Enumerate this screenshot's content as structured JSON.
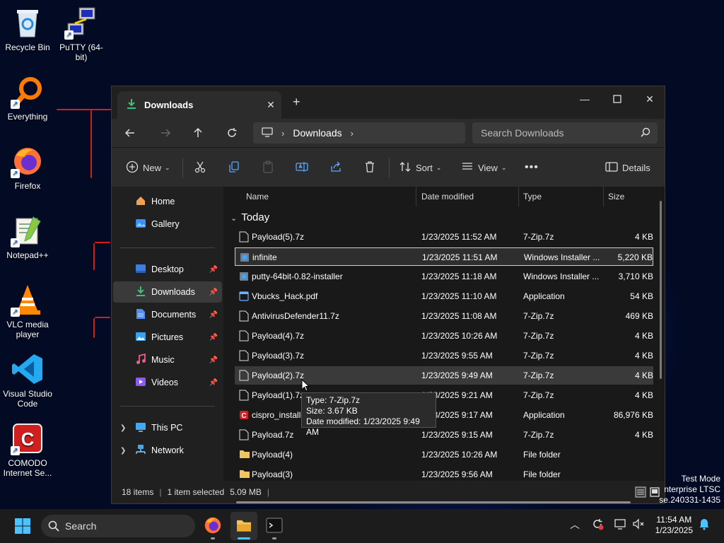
{
  "desktop": {
    "icons": [
      {
        "label": "Recycle Bin"
      },
      {
        "label": "PuTTY (64-bit)"
      },
      {
        "label": "Everything"
      },
      {
        "label": "Firefox"
      },
      {
        "label": "Notepad++"
      },
      {
        "label": "VLC media player"
      },
      {
        "label": "Visual Studio Code"
      },
      {
        "label": "COMODO Internet Se..."
      }
    ]
  },
  "window": {
    "tab_title": "Downloads",
    "nav": {
      "address": "Downloads",
      "search_placeholder": "Search Downloads"
    },
    "toolbar": {
      "new_label": "New",
      "sort_label": "Sort",
      "view_label": "View",
      "details_label": "Details"
    },
    "sidebar": {
      "items": [
        {
          "label": "Home"
        },
        {
          "label": "Gallery"
        },
        {
          "label": "Desktop"
        },
        {
          "label": "Downloads"
        },
        {
          "label": "Documents"
        },
        {
          "label": "Pictures"
        },
        {
          "label": "Music"
        },
        {
          "label": "Videos"
        },
        {
          "label": "This PC"
        },
        {
          "label": "Network"
        }
      ]
    },
    "columns": {
      "name": "Name",
      "date": "Date modified",
      "type": "Type",
      "size": "Size"
    },
    "group_label": "Today",
    "files": [
      {
        "name": "Payload(5).7z",
        "date": "1/23/2025 11:52 AM",
        "type": "7-Zip.7z",
        "size": "4 KB"
      },
      {
        "name": "infinite",
        "date": "1/23/2025 11:51 AM",
        "type": "Windows Installer ...",
        "size": "5,220 KB"
      },
      {
        "name": "putty-64bit-0.82-installer",
        "date": "1/23/2025 11:18 AM",
        "type": "Windows Installer ...",
        "size": "3,710 KB"
      },
      {
        "name": "Vbucks_Hack.pdf",
        "date": "1/23/2025 11:10 AM",
        "type": "Application",
        "size": "54 KB"
      },
      {
        "name": "AntivirusDefender11.7z",
        "date": "1/23/2025 11:08 AM",
        "type": "7-Zip.7z",
        "size": "469 KB"
      },
      {
        "name": "Payload(4).7z",
        "date": "1/23/2025 10:26 AM",
        "type": "7-Zip.7z",
        "size": "4 KB"
      },
      {
        "name": "Payload(3).7z",
        "date": "1/23/2025 9:55 AM",
        "type": "7-Zip.7z",
        "size": "4 KB"
      },
      {
        "name": "Payload(2).7z",
        "date": "1/23/2025 9:49 AM",
        "type": "7-Zip.7z",
        "size": "4 KB"
      },
      {
        "name": "Payload(1).7z",
        "date": "1/23/2025 9:21 AM",
        "type": "7-Zip.7z",
        "size": "4 KB"
      },
      {
        "name": "cispro_installe",
        "date": "1/23/2025 9:17 AM",
        "type": "Application",
        "size": "86,976 KB"
      },
      {
        "name": "Payload.7z",
        "date": "1/23/2025 9:15 AM",
        "type": "7-Zip.7z",
        "size": "4 KB"
      },
      {
        "name": "Payload(4)",
        "date": "1/23/2025 10:26 AM",
        "type": "File folder",
        "size": ""
      },
      {
        "name": "Payload(3)",
        "date": "1/23/2025 9:56 AM",
        "type": "File folder",
        "size": ""
      }
    ],
    "tooltip": {
      "type": "Type: 7-Zip.7z",
      "size": "Size: 3.67 KB",
      "date": "Date modified: 1/23/2025 9:49 AM"
    },
    "status": {
      "items": "18 items",
      "selected": "1 item selected",
      "selected_size": "5.09 MB"
    }
  },
  "watermark": {
    "line1": "Test Mode",
    "line2": "nterprise LTSC",
    "line3": "se.240331-1435"
  },
  "taskbar": {
    "search_label": "Search",
    "time": "11:54 AM",
    "date": "1/23/2025"
  }
}
